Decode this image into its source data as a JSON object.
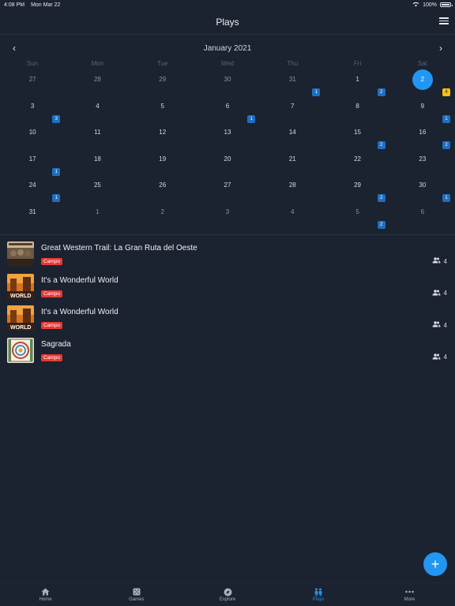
{
  "status_bar": {
    "time": "4:08 PM",
    "date": "Mon Mar 22",
    "battery": "100%"
  },
  "header": {
    "title": "Plays"
  },
  "calendar": {
    "month": "January 2021",
    "weekdays": [
      "Sun",
      "Mon",
      "Tue",
      "Wed",
      "Thu",
      "Fri",
      "Sat"
    ],
    "weeks": [
      [
        {
          "day": "27",
          "other": true
        },
        {
          "day": "28",
          "other": true
        },
        {
          "day": "29",
          "other": true
        },
        {
          "day": "30",
          "other": true
        },
        {
          "day": "31",
          "other": true,
          "badge": "1"
        },
        {
          "day": "1",
          "badge": "2"
        },
        {
          "day": "2",
          "selected": true,
          "badge": "4",
          "badge_color": "yellow"
        }
      ],
      [
        {
          "day": "3",
          "badge": "3"
        },
        {
          "day": "4"
        },
        {
          "day": "5"
        },
        {
          "day": "6",
          "badge": "1"
        },
        {
          "day": "7"
        },
        {
          "day": "8"
        },
        {
          "day": "9",
          "badge": "1"
        }
      ],
      [
        {
          "day": "10"
        },
        {
          "day": "11"
        },
        {
          "day": "12"
        },
        {
          "day": "13"
        },
        {
          "day": "14"
        },
        {
          "day": "15",
          "badge": "2"
        },
        {
          "day": "16",
          "badge": "2"
        }
      ],
      [
        {
          "day": "17",
          "badge": "1"
        },
        {
          "day": "18"
        },
        {
          "day": "19"
        },
        {
          "day": "20"
        },
        {
          "day": "21"
        },
        {
          "day": "22"
        },
        {
          "day": "23"
        }
      ],
      [
        {
          "day": "24",
          "badge": "1"
        },
        {
          "day": "25"
        },
        {
          "day": "26"
        },
        {
          "day": "27"
        },
        {
          "day": "28"
        },
        {
          "day": "29",
          "badge": "2"
        },
        {
          "day": "30",
          "badge": "1"
        }
      ],
      [
        {
          "day": "31"
        },
        {
          "day": "1",
          "other": true
        },
        {
          "day": "2",
          "other": true
        },
        {
          "day": "3",
          "other": true
        },
        {
          "day": "4",
          "other": true
        },
        {
          "day": "5",
          "other": true,
          "badge": "2"
        },
        {
          "day": "6",
          "other": true
        }
      ]
    ]
  },
  "plays": [
    {
      "title": "Great Western Trail: La Gran Ruta del Oeste",
      "location": "Campo",
      "players": "4",
      "thumb": "gwt"
    },
    {
      "title": "It's a Wonderful World",
      "location": "Campo",
      "players": "4",
      "thumb": "world"
    },
    {
      "title": "It's a Wonderful World",
      "location": "Campo",
      "players": "4",
      "thumb": "world"
    },
    {
      "title": "Sagrada",
      "location": "Campo",
      "players": "4",
      "thumb": "sagrada"
    }
  ],
  "thumb_labels": {
    "world": "WORLD"
  },
  "fab": {
    "label": "+"
  },
  "tabs": [
    {
      "label": "Home",
      "icon": "home-icon",
      "active": false
    },
    {
      "label": "Games",
      "icon": "dice-icon",
      "active": false
    },
    {
      "label": "Explore",
      "icon": "compass-icon",
      "active": false
    },
    {
      "label": "Plays",
      "icon": "people-icon",
      "active": true
    },
    {
      "label": "More",
      "icon": "more-icon",
      "active": false
    }
  ],
  "colors": {
    "accent": "#2196f3",
    "badge": "#1e6fc2",
    "badge_highlight": "#f4c20d",
    "tag": "#e53935",
    "background": "#1b2230"
  }
}
